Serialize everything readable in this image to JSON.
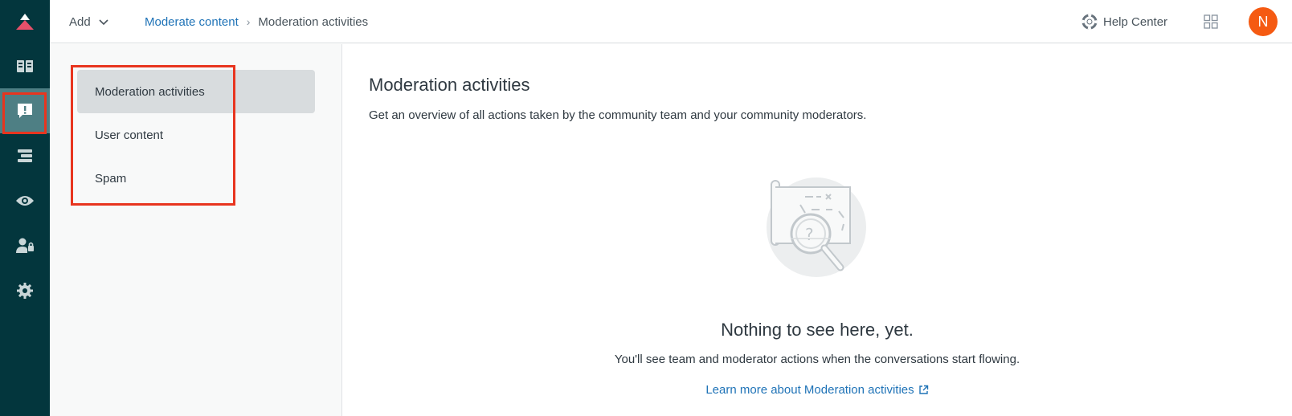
{
  "topbar": {
    "add_label": "Add",
    "breadcrumb": {
      "parent": "Moderate content",
      "current": "Moderation activities"
    },
    "help_center_label": "Help Center",
    "avatar_initial": "N"
  },
  "rail": {
    "items": [
      {
        "icon": "guide-book-icon"
      },
      {
        "icon": "moderation-alert-icon",
        "active": true
      },
      {
        "icon": "topics-stack-icon"
      },
      {
        "icon": "eye-icon"
      },
      {
        "icon": "user-permissions-icon"
      },
      {
        "icon": "gear-icon"
      }
    ]
  },
  "subnav": {
    "items": [
      {
        "label": "Moderation activities",
        "active": true
      },
      {
        "label": "User content"
      },
      {
        "label": "Spam"
      }
    ]
  },
  "main": {
    "title": "Moderation activities",
    "description": "Get an overview of all actions taken by the community team and your community moderators.",
    "empty_title": "Nothing to see here, yet.",
    "empty_text": "You'll see team and moderator actions when the conversations start flowing.",
    "learn_more": "Learn more about Moderation activities"
  },
  "colors": {
    "rail_bg": "#03363d",
    "rail_active": "#4e7f84",
    "brand_red": "#e8351f",
    "link_blue": "#1f73b7",
    "avatar_orange": "#f55a12"
  }
}
